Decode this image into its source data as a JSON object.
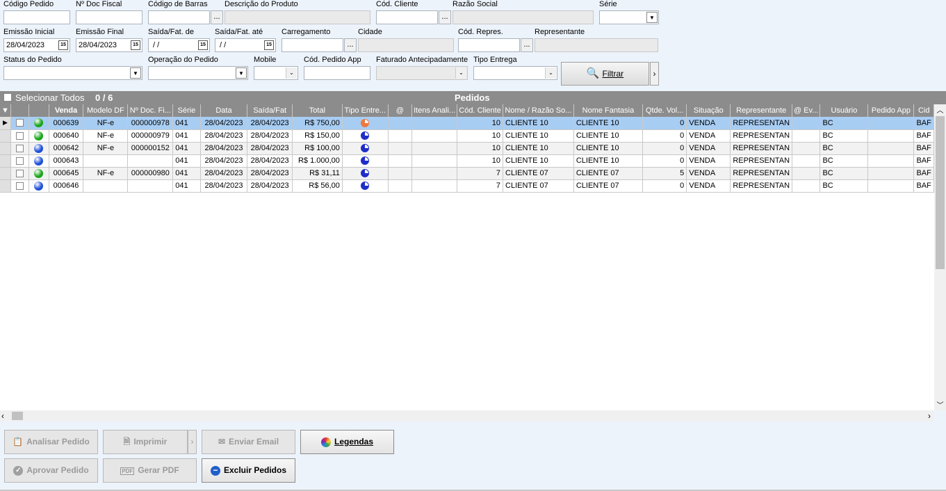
{
  "filters": {
    "codigo_pedido": "Código Pedido",
    "n_doc_fiscal": "Nº Doc Fiscal",
    "codigo_barras": "Código de Barras",
    "desc_produto": "Descrição do Produto",
    "cod_cliente": "Cód. Cliente",
    "razao_social": "Razão Social",
    "serie": "Série",
    "emissao_inicial": "Emissão Inicial",
    "emissao_inicial_val": "28/04/2023",
    "emissao_final": "Emissão Final",
    "emissao_final_val": "28/04/2023",
    "saida_de": "Saída/Fat. de",
    "saida_de_val": " / /",
    "saida_ate": "Saída/Fat. até",
    "saida_ate_val": " / /",
    "carregamento": "Carregamento",
    "cidade": "Cidade",
    "cod_repres": "Cód. Repres.",
    "representante": "Representante",
    "status_pedido": "Status do Pedido",
    "operacao_pedido": "Operação do Pedido",
    "mobile": "Mobile",
    "cod_pedido_app": "Cód. Pedido App",
    "faturado_antecipadamente": "Faturado Antecipadamente",
    "tipo_entrega": "Tipo Entrega",
    "filtrar": "Filtrar",
    "ellipsis": "...",
    "cal": "15"
  },
  "grid": {
    "select_all": "Selecionar Todos",
    "count": "0 / 6",
    "title": "Pedidos",
    "columns": [
      "Venda",
      "Modelo DF",
      "Nº Doc. Fi...",
      "Série",
      "Data",
      "Saída/Fat",
      "Total",
      "Tipo Entre...",
      "@",
      "Itens Anali...",
      "Cód. Cliente",
      "Nome / Razão So...",
      "Nome Fantasia",
      "Qtde. Vol...",
      "Situação",
      "Representante",
      "@ Ev...",
      "Usuário",
      "Pedido App",
      "Cid"
    ],
    "rows": [
      {
        "venda": "000639",
        "modelo": "NF-e",
        "doc": "000000978",
        "serie": "041",
        "data": "28/04/2023",
        "saida": "28/04/2023",
        "total": "R$ 750,00",
        "cod": "10",
        "nome": "CLIENTE 10",
        "fantasia": "CLIENTE 10",
        "qtde": "0",
        "situacao": "VENDA",
        "repres": "REPRESENTAN",
        "usuario": "BC",
        "cid": "BAF",
        "ball": "#1aa51a",
        "pie": "#f0783c"
      },
      {
        "venda": "000640",
        "modelo": "NF-e",
        "doc": "000000979",
        "serie": "041",
        "data": "28/04/2023",
        "saida": "28/04/2023",
        "total": "R$ 150,00",
        "cod": "10",
        "nome": "CLIENTE 10",
        "fantasia": "CLIENTE 10",
        "qtde": "0",
        "situacao": "VENDA",
        "repres": "REPRESENTAN",
        "usuario": "BC",
        "cid": "BAF",
        "ball": "#1aa51a",
        "pie": "#1f2ec8"
      },
      {
        "venda": "000642",
        "modelo": "NF-e",
        "doc": "000000152",
        "serie": "041",
        "data": "28/04/2023",
        "saida": "28/04/2023",
        "total": "R$ 100,00",
        "cod": "10",
        "nome": "CLIENTE 10",
        "fantasia": "CLIENTE 10",
        "qtde": "0",
        "situacao": "VENDA",
        "repres": "REPRESENTAN",
        "usuario": "BC",
        "cid": "BAF",
        "ball": "#1d4fd8",
        "pie": "#1f2ec8"
      },
      {
        "venda": "000643",
        "modelo": "",
        "doc": "",
        "serie": "041",
        "data": "28/04/2023",
        "saida": "28/04/2023",
        "total": "R$ 1.000,00",
        "cod": "10",
        "nome": "CLIENTE 10",
        "fantasia": "CLIENTE 10",
        "qtde": "0",
        "situacao": "VENDA",
        "repres": "REPRESENTAN",
        "usuario": "BC",
        "cid": "BAF",
        "ball": "#1d4fd8",
        "pie": "#1f2ec8"
      },
      {
        "venda": "000645",
        "modelo": "NF-e",
        "doc": "000000980",
        "serie": "041",
        "data": "28/04/2023",
        "saida": "28/04/2023",
        "total": "R$ 31,11",
        "cod": "7",
        "nome": "CLIENTE 07",
        "fantasia": "CLIENTE 07",
        "qtde": "5",
        "situacao": "VENDA",
        "repres": "REPRESENTAN",
        "usuario": "BC",
        "cid": "BAF",
        "ball": "#1aa51a",
        "pie": "#1f2ec8"
      },
      {
        "venda": "000646",
        "modelo": "",
        "doc": "",
        "serie": "041",
        "data": "28/04/2023",
        "saida": "28/04/2023",
        "total": "R$ 56,00",
        "cod": "7",
        "nome": "CLIENTE 07",
        "fantasia": "CLIENTE 07",
        "qtde": "0",
        "situacao": "VENDA",
        "repres": "REPRESENTAN",
        "usuario": "BC",
        "cid": "BAF",
        "ball": "#1d4fd8",
        "pie": "#1f2ec8"
      }
    ]
  },
  "actions": {
    "analisar": "Analisar Pedido",
    "imprimir": "Imprimir",
    "enviar_email": "Enviar Email",
    "legendas": "Legendas",
    "aprovar": "Aprovar Pedido",
    "gerar_pdf": "Gerar PDF",
    "excluir": "Excluir Pedidos"
  }
}
